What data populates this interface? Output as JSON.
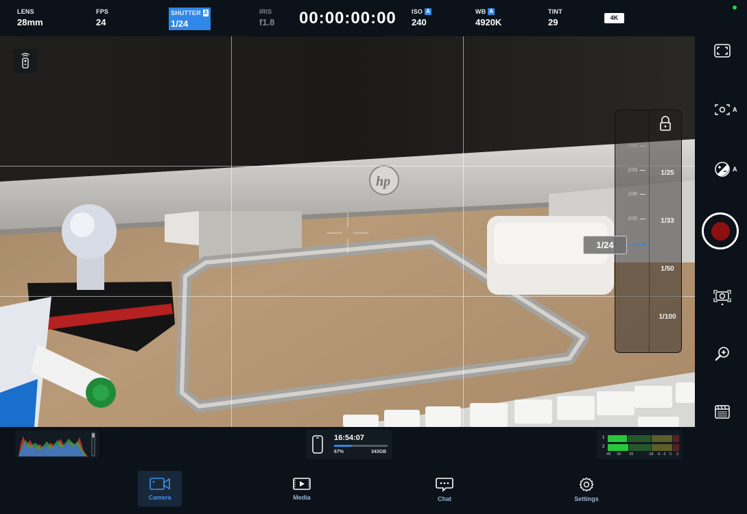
{
  "top_bar": {
    "lens": {
      "label": "LENS",
      "value": "28mm"
    },
    "fps": {
      "label": "FPS",
      "value": "24"
    },
    "shutter": {
      "label": "SHUTTER",
      "value": "1/24",
      "auto": "A"
    },
    "iris": {
      "label": "IRIS",
      "value": "f1.8"
    },
    "timecode": "00:00:00:00",
    "iso": {
      "label": "ISO",
      "value": "240",
      "auto": "A"
    },
    "wb": {
      "label": "WB",
      "value": "4920K",
      "auto": "A"
    },
    "tint": {
      "label": "TINT",
      "value": "29"
    },
    "resolution": "4K",
    "status_color": "#27d34a"
  },
  "shutter_dial": {
    "current": "1/24",
    "values": [
      "1/25",
      "1/33",
      "1/50",
      "1/100"
    ],
    "ticks": [
      "1/40",
      "1/33",
      "1/30",
      "1/25"
    ],
    "locked_icon": "lock-icon"
  },
  "sidebar": {
    "auto_focus_badge": "A",
    "auto_exposure_badge": "A",
    "icons": [
      "fullscreen-icon",
      "autofocus-icon",
      "exposure-icon",
      "record-button",
      "stabilization-icon",
      "zoom-icon",
      "slate-icon"
    ]
  },
  "status_strip": {
    "clock": "16:54:07",
    "storage_percent_label": "67%",
    "storage_fraction": 0.33,
    "storage_free": "343GB",
    "audio": {
      "channels": [
        "1",
        "2"
      ],
      "db_labels": [
        "-45",
        "-30",
        "-20",
        "-18",
        "-6",
        "-3",
        "0",
        "3"
      ]
    }
  },
  "bottom_nav": {
    "items": [
      {
        "label": "Camera",
        "icon": "camera-icon",
        "active": true
      },
      {
        "label": "Media",
        "icon": "media-icon",
        "active": false
      },
      {
        "label": "Chat",
        "icon": "chat-icon",
        "active": false
      },
      {
        "label": "Settings",
        "icon": "settings-icon",
        "active": false
      }
    ]
  },
  "colors": {
    "accent": "#2f87e8",
    "background": "#0c1219",
    "record": "#8c1010"
  }
}
